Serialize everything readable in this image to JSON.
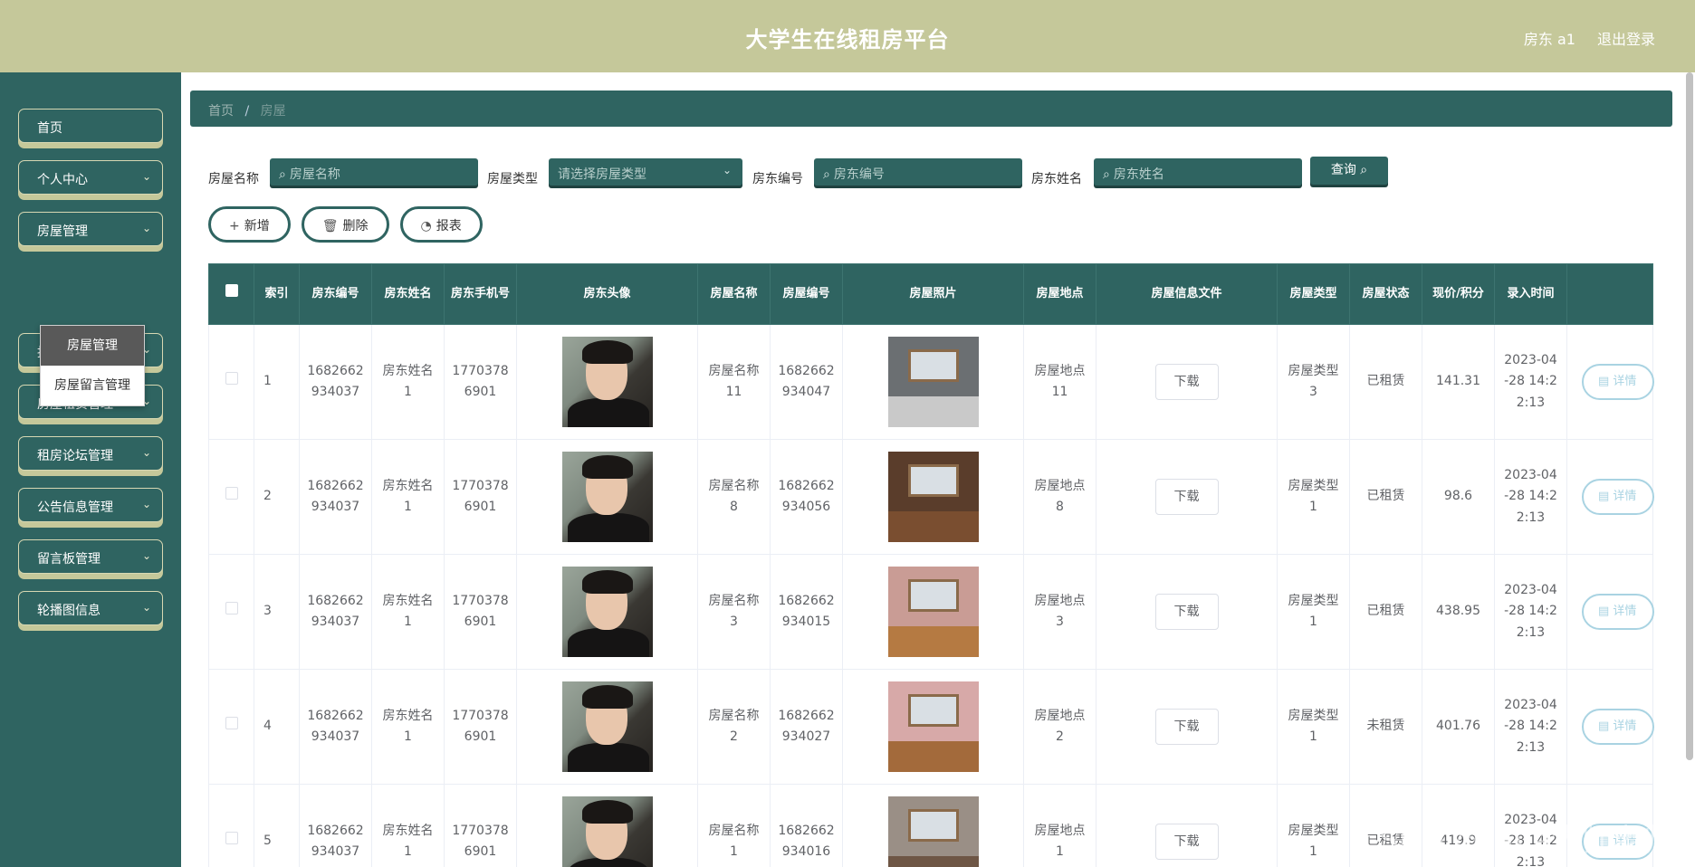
{
  "app": {
    "title": "大学生在线租房平台",
    "user": "房东 a1",
    "logout": "退出登录"
  },
  "sidebar": {
    "items": [
      {
        "label": "首页",
        "has_arrow": false
      },
      {
        "label": "个人中心",
        "has_arrow": true
      },
      {
        "label": "房屋管理",
        "has_arrow": true
      },
      {
        "label": "报修管理",
        "has_arrow": true
      },
      {
        "label": "房屋租赁管理",
        "has_arrow": true
      },
      {
        "label": "租房论坛管理",
        "has_arrow": true
      },
      {
        "label": "公告信息管理",
        "has_arrow": true
      },
      {
        "label": "留言板管理",
        "has_arrow": true
      },
      {
        "label": "轮播图信息",
        "has_arrow": true
      }
    ],
    "submenu": [
      {
        "label": "房屋管理",
        "active": true
      },
      {
        "label": "房屋留言管理",
        "active": false
      }
    ]
  },
  "breadcrumb": {
    "home": "首页",
    "sep": "/",
    "current": "房屋"
  },
  "search": {
    "name_label": "房屋名称",
    "name_placeholder": "房屋名称",
    "type_label": "房屋类型",
    "type_placeholder": "请选择房屋类型",
    "landlord_no_label": "房东编号",
    "landlord_no_placeholder": "房东编号",
    "landlord_name_label": "房东姓名",
    "landlord_name_placeholder": "房东姓名",
    "query": "查询"
  },
  "actions": {
    "add": "新增",
    "delete": "删除",
    "report": "报表"
  },
  "table": {
    "headers": [
      "索引",
      "房东编号",
      "房东姓名",
      "房东手机号",
      "房东头像",
      "房屋名称",
      "房屋编号",
      "房屋照片",
      "房屋地点",
      "房屋信息文件",
      "房屋类型",
      "房屋状态",
      "现价/积分",
      "录入时间",
      ""
    ],
    "download_label": "下载",
    "detail_label": "详情",
    "rows": [
      {
        "index": "1",
        "landlord_no": "1682662934037",
        "landlord_name": "房东姓名1",
        "phone": "17703786901",
        "house_name": "房屋名称11",
        "house_no": "1682662934047",
        "location": "房屋地点11",
        "type": "房屋类型3",
        "status": "已租赁",
        "price": "141.31",
        "time": "2023-04-28 14:22:13"
      },
      {
        "index": "2",
        "landlord_no": "1682662934037",
        "landlord_name": "房东姓名1",
        "phone": "17703786901",
        "house_name": "房屋名称8",
        "house_no": "1682662934056",
        "location": "房屋地点8",
        "type": "房屋类型1",
        "status": "已租赁",
        "price": "98.6",
        "time": "2023-04-28 14:22:13"
      },
      {
        "index": "3",
        "landlord_no": "1682662934037",
        "landlord_name": "房东姓名1",
        "phone": "17703786901",
        "house_name": "房屋名称3",
        "house_no": "1682662934015",
        "location": "房屋地点3",
        "type": "房屋类型1",
        "status": "已租赁",
        "price": "438.95",
        "time": "2023-04-28 14:22:13"
      },
      {
        "index": "4",
        "landlord_no": "1682662934037",
        "landlord_name": "房东姓名1",
        "phone": "17703786901",
        "house_name": "房屋名称2",
        "house_no": "1682662934027",
        "location": "房屋地点2",
        "type": "房屋类型1",
        "status": "未租赁",
        "price": "401.76",
        "time": "2023-04-28 14:22:13"
      },
      {
        "index": "5",
        "landlord_no": "1682662934037",
        "landlord_name": "房东姓名1",
        "phone": "17703786901",
        "house_name": "房屋名称1",
        "house_no": "1682662934016",
        "location": "房屋地点1",
        "type": "房屋类型1",
        "status": "已租赁",
        "price": "419.9",
        "time": "2023-04-28 14:22:13"
      }
    ]
  },
  "watermark": "CSDN @Java大师老师",
  "colors": {
    "primary": "#2f6461",
    "header": "#c5c89a",
    "detail": "#a9d3e2"
  }
}
